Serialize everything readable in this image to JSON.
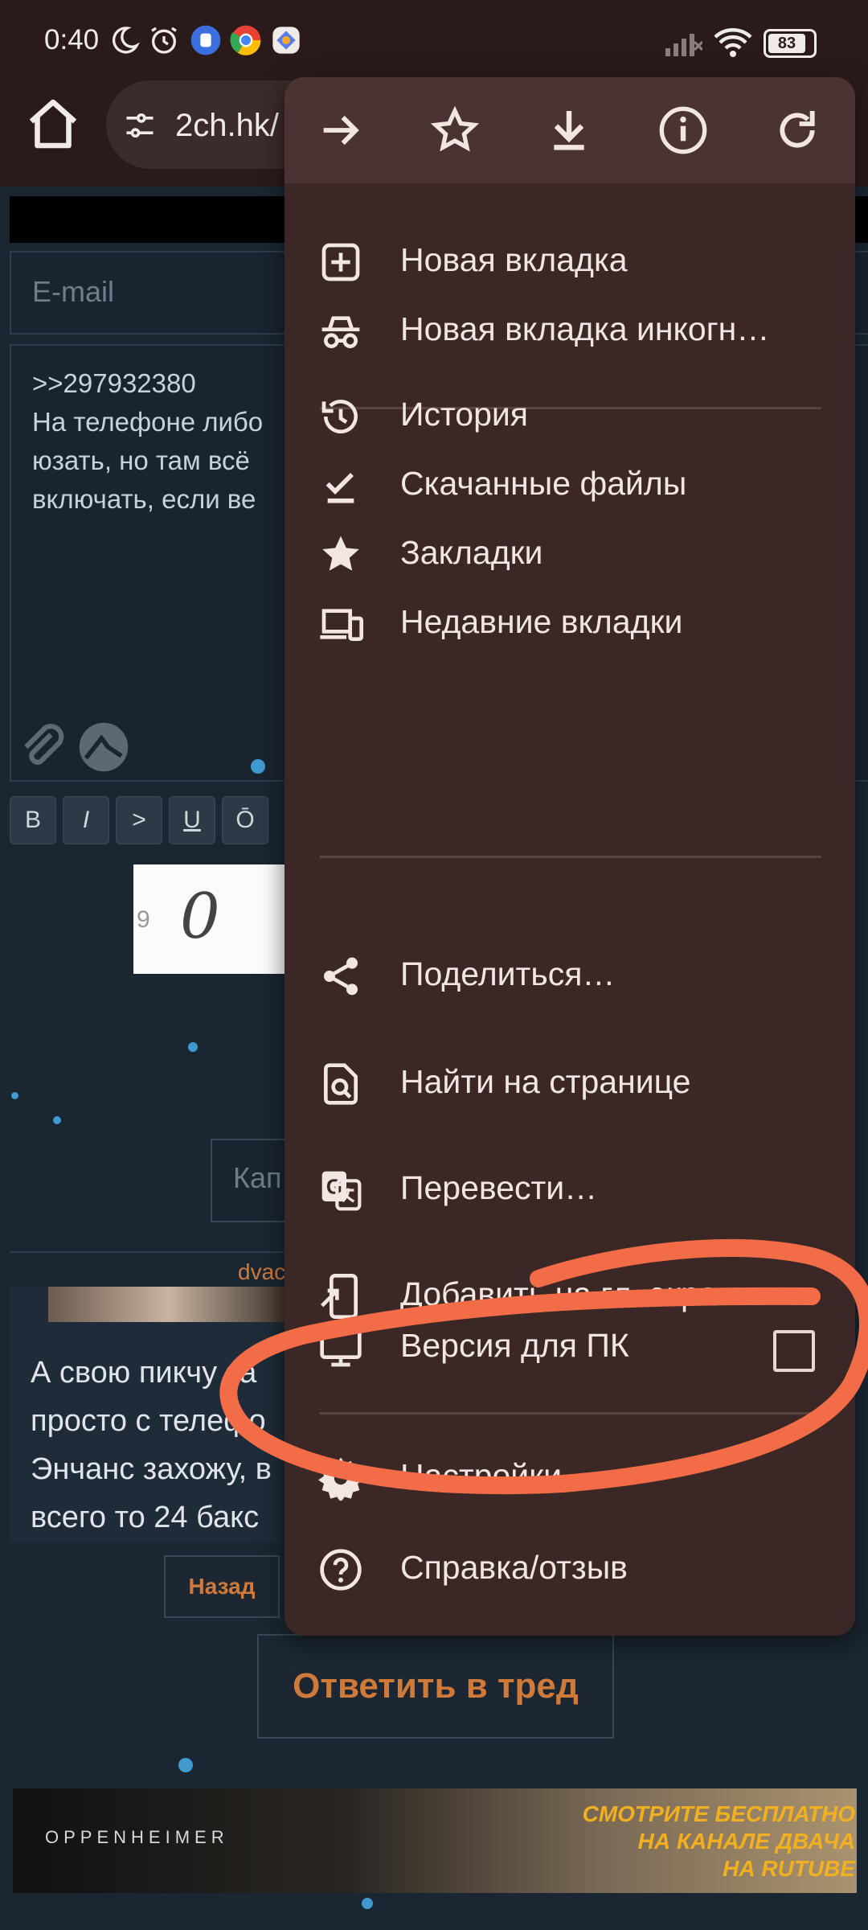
{
  "status_bar": {
    "time": "0:40",
    "battery": "83",
    "icons": [
      "moon-icon",
      "alarm-icon",
      "app-icon",
      "chrome-icon",
      "gallery-icon",
      "signal-icon",
      "wifi-icon",
      "battery-icon"
    ]
  },
  "browser": {
    "url": "2ch.hk/",
    "home_icon": "home-icon",
    "site_settings_icon": "tune-icon"
  },
  "page": {
    "email_placeholder": "E-mail",
    "message_lines": [
      ">>297932380",
      "На телефоне либо",
      "юзать, но  там всё",
      "включать, если ве"
    ],
    "format_buttons": [
      "B",
      "I",
      ">",
      "U",
      "Ō"
    ],
    "captcha_digits": "0",
    "captcha_prefix": "9",
    "captcha_placeholder": "Кап",
    "dvach_text": "dvac",
    "post_lines": [
      "А свою пикчу за",
      "просто с телефо",
      "Энчанс захожу, в",
      "всего то 24 бакс"
    ],
    "back_button": "Назад",
    "reply_button": "Ответить в тред",
    "banner": {
      "brand": "OPPENHEIMER",
      "line1": "СМОТРИТЕ БЕСПЛАТНО",
      "line2": "НА КАНАЛЕ ДВАЧА",
      "line3": "НА RUTUBE"
    }
  },
  "menu": {
    "toolbar_icons": [
      "forward-icon",
      "bookmark-star-icon",
      "download-icon",
      "info-icon",
      "reload-icon"
    ],
    "items": [
      {
        "label": "Новая вкладка",
        "icon": "new-tab-icon"
      },
      {
        "label": "Новая вкладка инкогн…",
        "icon": "incognito-icon"
      },
      {
        "label": "История",
        "icon": "history-icon"
      },
      {
        "label": "Скачанные файлы",
        "icon": "downloads-icon"
      },
      {
        "label": "Закладки",
        "icon": "bookmarks-icon"
      },
      {
        "label": "Недавние вкладки",
        "icon": "recent-tabs-icon"
      },
      {
        "label": "Поделиться…",
        "icon": "share-icon"
      },
      {
        "label": "Найти на странице",
        "icon": "find-in-page-icon"
      },
      {
        "label": "Перевести…",
        "icon": "translate-icon"
      },
      {
        "label": "Добавить на гл. экран",
        "icon": "add-to-home-icon"
      },
      {
        "label": "Версия для ПК",
        "icon": "desktop-icon",
        "checked": false
      },
      {
        "label": "Настройки",
        "icon": "settings-icon"
      },
      {
        "label": "Справка/отзыв",
        "icon": "help-icon"
      }
    ]
  },
  "colors": {
    "menu_bg": "#3a2726",
    "accent_orange": "#f26d47",
    "page_bg": "#1b2633",
    "link_orange": "#d07a3a"
  }
}
